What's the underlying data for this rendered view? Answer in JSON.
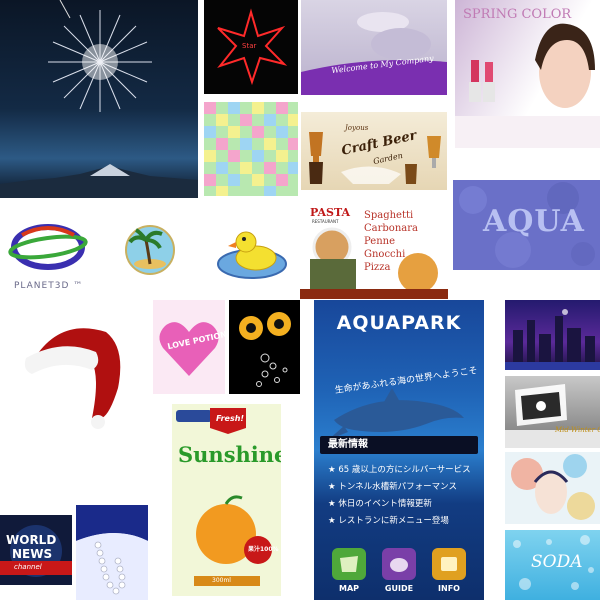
{
  "company": {
    "banner": "Welcome to My Company"
  },
  "spring": {
    "title": "SPRING COLOR"
  },
  "neon": {
    "label": "Star"
  },
  "beer": {
    "line1": "Joyous",
    "line2": "Craft Beer",
    "line3": "Garden"
  },
  "aqua": {
    "text": "AQUA"
  },
  "planet": {
    "label": "PLANET3D ™"
  },
  "pasta": {
    "header": "PASTA",
    "sub": "RESTAURANT",
    "items": [
      "Spaghetti",
      "Carbonara",
      "Penne",
      "Gnocchi",
      "Pizza"
    ]
  },
  "heart": {
    "text": "LOVE POTION"
  },
  "aquapark": {
    "title": "AQUAPARK",
    "tagline": "生命があふれる海の世界へようこそ",
    "news_heading": "最新情報",
    "news": [
      "★ 65 歳以上の方にシルバーサービス",
      "★ トンネル水槽新パフォーマンス",
      "★ 休日のイベント情報更新",
      "★ レストランに新メニュー登場"
    ],
    "nav": [
      {
        "label": "MAP",
        "color": "#4fa83a"
      },
      {
        "label": "GUIDE",
        "color": "#7a3fa8"
      },
      {
        "label": "INFO",
        "color": "#e0a020"
      }
    ]
  },
  "winter": {
    "text": "Mid-Winter Greetings!"
  },
  "sunshine": {
    "fresh": "Fresh!",
    "title": "Sunshine",
    "badge": "果汁100%",
    "volume": "300ml"
  },
  "news_tile": {
    "line1": "WORLD",
    "line2": "NEWS",
    "line3": "channel"
  },
  "soda": {
    "text": "SODA"
  }
}
